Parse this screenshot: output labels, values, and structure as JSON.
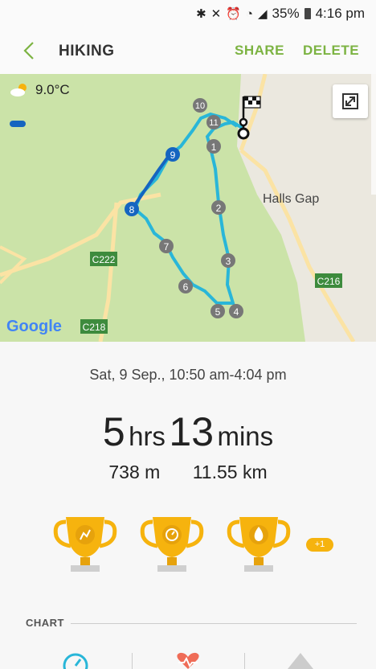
{
  "status": {
    "battery": "35%",
    "time": "4:16 pm"
  },
  "appbar": {
    "title": "HIKING",
    "share": "SHARE",
    "delete": "DELETE"
  },
  "map": {
    "temperature": "9.0°C",
    "town": "Halls Gap",
    "roads": [
      "C222",
      "C218",
      "C216"
    ],
    "google": "Google",
    "waypoints": [
      "1",
      "2",
      "3",
      "4",
      "5",
      "6",
      "7",
      "8",
      "9",
      "10",
      "11"
    ]
  },
  "workout": {
    "date": "Sat, 9 Sep., 10:50 am-4:04 pm",
    "hours_value": "5",
    "hours_unit": "hrs",
    "mins_value": "13",
    "mins_unit": "mins",
    "elevation": "738 m",
    "distance": "11.55 km",
    "trophy_extra": "+1"
  },
  "chart": {
    "label": "CHART"
  },
  "colors": {
    "accent": "#7cb342",
    "route": "#29b6d8",
    "route_active": "#1565c0",
    "trophy": "#f6b30e"
  }
}
